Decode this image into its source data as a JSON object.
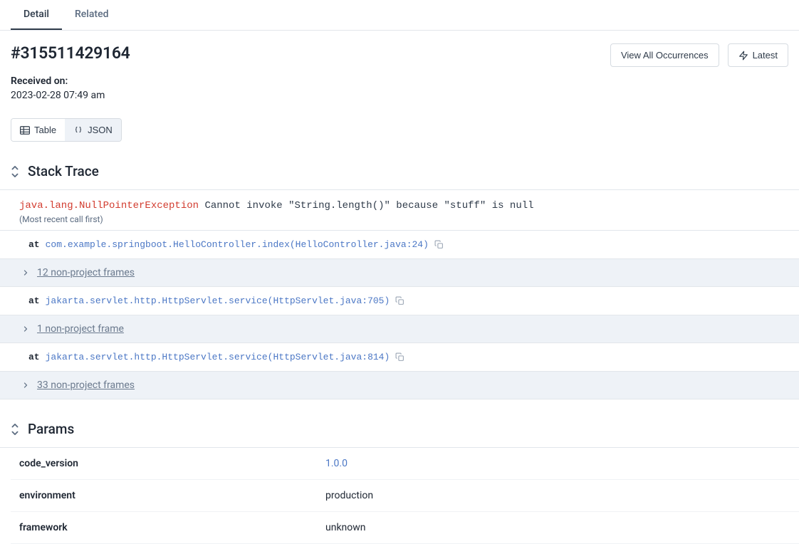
{
  "tabs": {
    "detail": "Detail",
    "related": "Related"
  },
  "header": {
    "id": "#315511429164",
    "view_all_label": "View All Occurrences",
    "latest_label": "Latest"
  },
  "meta": {
    "received_on_label": "Received on:",
    "received_on_value": "2023-02-28 07:49 am"
  },
  "view_toggle": {
    "table_label": "Table",
    "json_label": "JSON"
  },
  "stack_trace": {
    "title": "Stack Trace",
    "exception_class": "java.lang.NullPointerException",
    "exception_message": "Cannot invoke \"String.length()\" because \"stuff\" is null",
    "order_note": "(Most recent call first)",
    "frames": [
      {
        "type": "frame",
        "at_label": "at",
        "location": "com.example.springboot.HelloController.index(HelloController.java:24)"
      },
      {
        "type": "collapsed",
        "label": "12 non-project frames"
      },
      {
        "type": "frame",
        "at_label": "at",
        "location": "jakarta.servlet.http.HttpServlet.service(HttpServlet.java:705)"
      },
      {
        "type": "collapsed",
        "label": "1 non-project frame"
      },
      {
        "type": "frame",
        "at_label": "at",
        "location": "jakarta.servlet.http.HttpServlet.service(HttpServlet.java:814)"
      },
      {
        "type": "collapsed",
        "label": "33 non-project frames"
      }
    ]
  },
  "params": {
    "title": "Params",
    "rows": [
      {
        "key": "code_version",
        "value": "1.0.0",
        "is_link": true
      },
      {
        "key": "environment",
        "value": "production",
        "is_link": false
      },
      {
        "key": "framework",
        "value": "unknown",
        "is_link": false
      }
    ]
  }
}
